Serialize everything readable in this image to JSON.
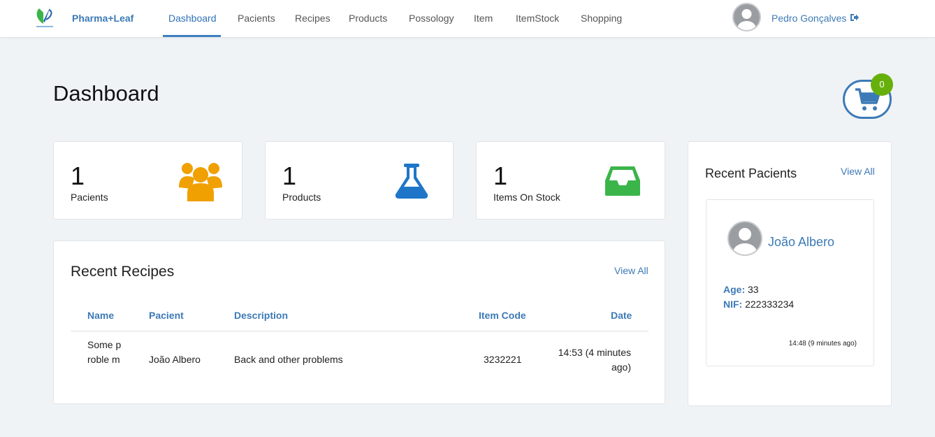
{
  "brand": {
    "name": "Pharma+Leaf",
    "logo_icon": "pharma-leaf-logo"
  },
  "nav": {
    "items": [
      "Dashboard",
      "Pacients",
      "Recipes",
      "Products",
      "Possology",
      "Item",
      "ItemStock",
      "Shopping"
    ],
    "active": "Dashboard"
  },
  "user": {
    "name": "Pedro Gonçalves",
    "logout_icon": "sign-out-icon"
  },
  "page": {
    "title": "Dashboard"
  },
  "cart": {
    "count": "0",
    "icon": "shopping-cart-icon"
  },
  "stats": [
    {
      "value": "1",
      "label": "Pacients",
      "icon": "users-icon",
      "color": "#f0a000"
    },
    {
      "value": "1",
      "label": "Products",
      "icon": "flask-icon",
      "color": "#1f76c9"
    },
    {
      "value": "1",
      "label": "Items On Stock",
      "icon": "inbox-icon",
      "color": "#3bb54a"
    }
  ],
  "recipes": {
    "title": "Recent Recipes",
    "view_all": "View All",
    "columns": [
      "Name",
      "Pacient",
      "Description",
      "Item Code",
      "Date"
    ],
    "rows": [
      {
        "name": "Some proble m",
        "pacient": "João Albero",
        "description": "Back and other problems",
        "item_code": "3232221",
        "date": "14:53 (4 minutes ago)"
      }
    ]
  },
  "pacients": {
    "title": "Recent Pacients",
    "view_all": "View All",
    "card": {
      "name": "João Albero",
      "age_label": "Age:",
      "age": "33",
      "nif_label": "NIF:",
      "nif": "222333234",
      "time": "14:48 (9 minutes ago)"
    }
  },
  "colors": {
    "accent": "#3c7ab6",
    "badge": "#67b00b",
    "background": "#eff3f6"
  }
}
